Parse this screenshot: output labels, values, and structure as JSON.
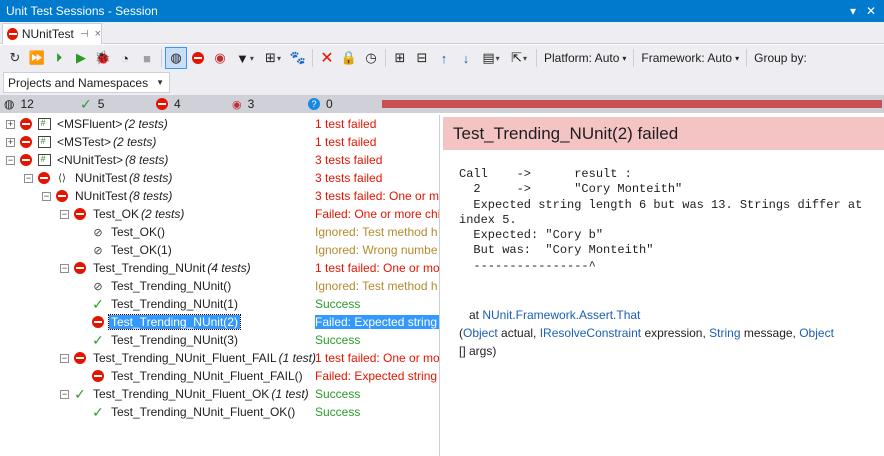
{
  "window": {
    "title": "Unit Test Sessions - Session"
  },
  "tab": {
    "label": "NUnitTest",
    "pin": "⊣",
    "close": "×"
  },
  "toolbar": {
    "platform_label": "Platform: Auto",
    "framework_label": "Framework: Auto",
    "groupby_label": "Group by:"
  },
  "grouping": {
    "selected": "Projects and Namespaces"
  },
  "summary": {
    "total": "12",
    "passed": "5",
    "failed": "4",
    "ignored": "3",
    "unknown": "0"
  },
  "tree": [
    {
      "name": "<MSFluent>",
      "count": "(2 tests)",
      "status": "1 test failed"
    },
    {
      "name": "<MSTest>",
      "count": "(2 tests)",
      "status": "1 test failed"
    },
    {
      "name": "<NUnitTest>",
      "count": "(8 tests)",
      "status": "3 tests failed"
    },
    {
      "name": "NUnitTest",
      "count": "(8 tests)",
      "status": "3 tests failed"
    },
    {
      "name": "NUnitTest",
      "count": "(8 tests)",
      "status": "3 tests failed: One or mo"
    },
    {
      "name": "Test_OK",
      "count": "(2 tests)",
      "status": "Failed: One or more chi"
    },
    {
      "name": "Test_OK()",
      "count": "",
      "status": "Ignored: Test method h"
    },
    {
      "name": "Test_OK(1)",
      "count": "",
      "status": "Ignored: Wrong numbe"
    },
    {
      "name": "Test_Trending_NUnit",
      "count": "(4 tests)",
      "status": "1 test failed: One or mo"
    },
    {
      "name": "Test_Trending_NUnit()",
      "count": "",
      "status": "Ignored: Test method h"
    },
    {
      "name": "Test_Trending_NUnit(1)",
      "count": "",
      "status": "Success"
    },
    {
      "name": "Test_Trending_NUnit(2)",
      "count": "",
      "status": "Failed:  Expected string"
    },
    {
      "name": "Test_Trending_NUnit(3)",
      "count": "",
      "status": "Success"
    },
    {
      "name": "Test_Trending_NUnit_Fluent_FAIL",
      "count": "(1 test)",
      "status": "1 test failed: One or mo"
    },
    {
      "name": "Test_Trending_NUnit_Fluent_FAIL()",
      "count": "",
      "status": "Failed: Expected string t"
    },
    {
      "name": "Test_Trending_NUnit_Fluent_OK",
      "count": "(1 test)",
      "status": "Success"
    },
    {
      "name": "Test_Trending_NUnit_Fluent_OK()",
      "count": "",
      "status": "Success"
    }
  ],
  "detail": {
    "title": "Test_Trending_NUnit(2) failed",
    "output": "Call    ->      result :\n  2     ->      \"Cory Monteith\"\n  Expected string length 6 but was 13. Strings differ at\nindex 5.\n  Expected: \"Cory b\"\n  But was:  \"Cory Monteith\"\n  ----------------^",
    "stack_at": "at ",
    "stack_method": "NUnit.Framework.Assert.That",
    "stack_p1": "(",
    "stack_t1": "Object",
    "stack_p2": " actual, ",
    "stack_t2": "IResolveConstraint",
    "stack_p3": " expression, ",
    "stack_t3": "String",
    "stack_p4": " message, ",
    "stack_t4": "Object",
    "stack_p5": "[] args)"
  }
}
